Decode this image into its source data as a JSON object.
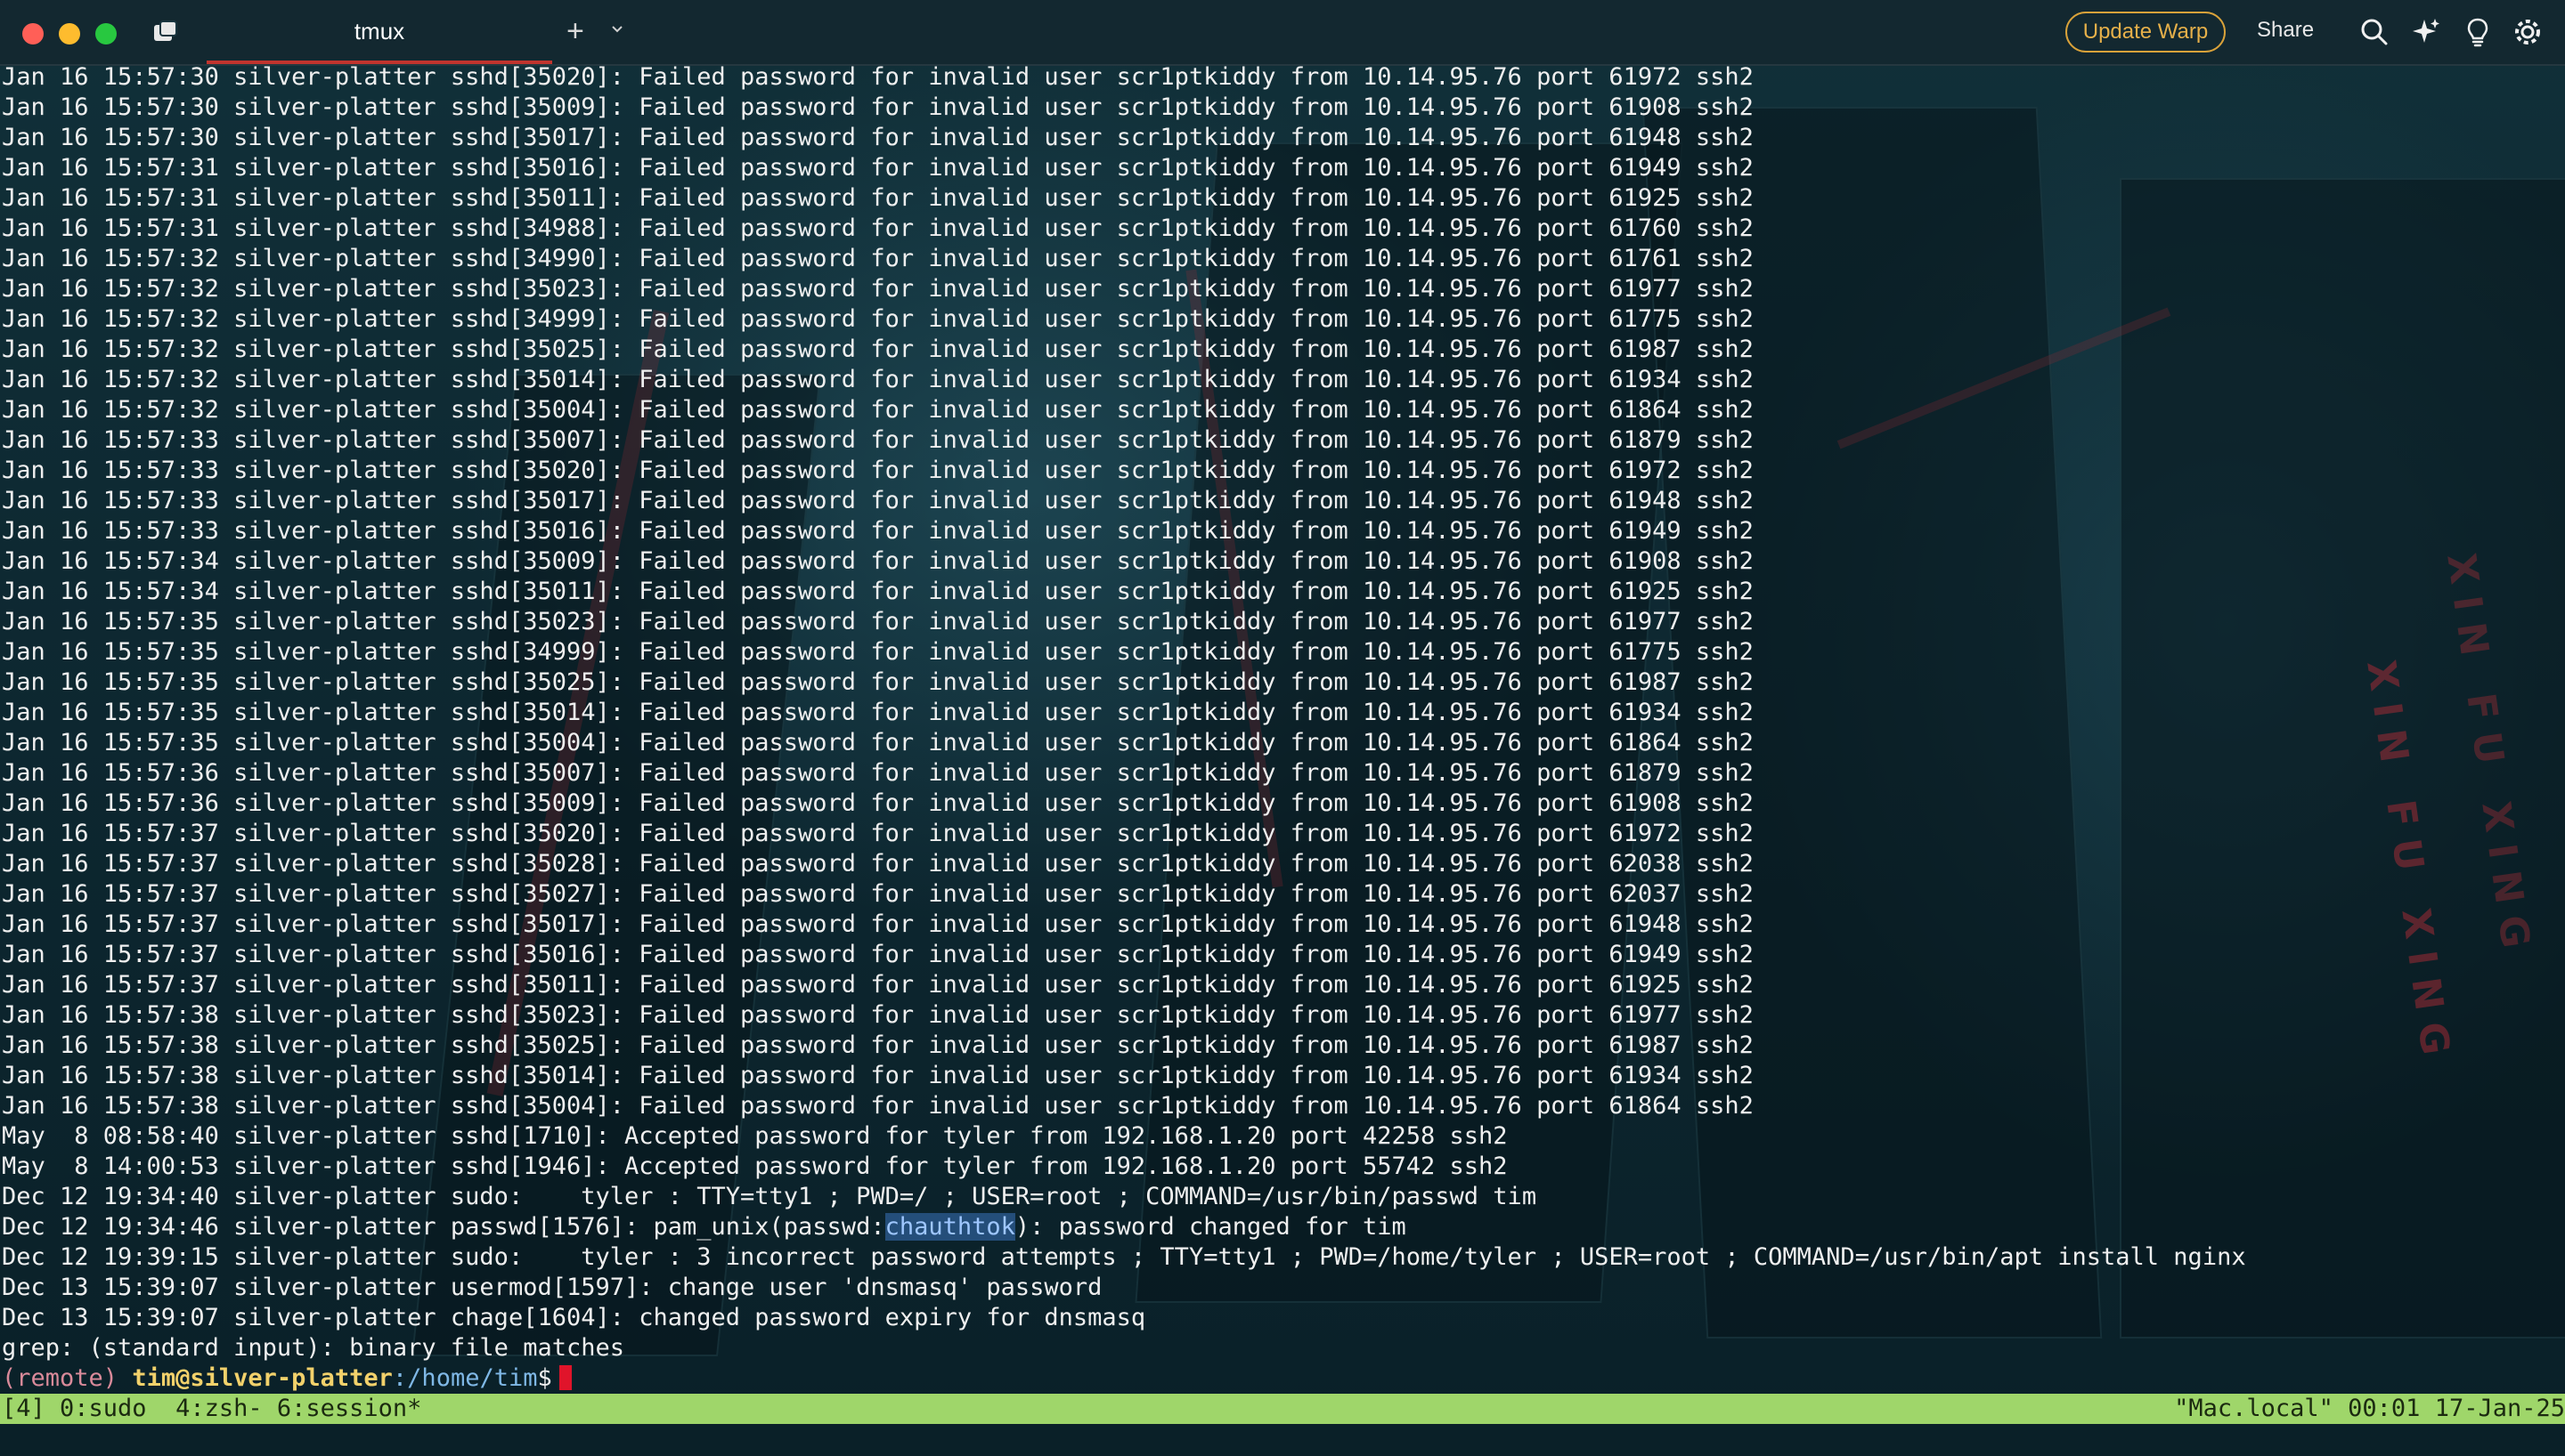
{
  "window": {
    "tab_title": "tmux",
    "new_tab_label": "+",
    "update_button": "Update Warp",
    "share_button": "Share",
    "colors": {
      "tab_accent": "#c0342e",
      "update_accent": "#d9a23a",
      "status_bar": "#9fd66a",
      "cursor": "#e0142a"
    },
    "icons": [
      "tabs-panel-icon",
      "plus-icon",
      "chevron-down-icon",
      "search-icon",
      "ai-sparkle-icon",
      "lightbulb-icon",
      "settings-gear-icon"
    ]
  },
  "terminal": {
    "lines": [
      "Jan 16 15:57:30 silver-platter sshd[35020]: Failed password for invalid user scr1ptkiddy from 10.14.95.76 port 61972 ssh2",
      "Jan 16 15:57:30 silver-platter sshd[35009]: Failed password for invalid user scr1ptkiddy from 10.14.95.76 port 61908 ssh2",
      "Jan 16 15:57:30 silver-platter sshd[35017]: Failed password for invalid user scr1ptkiddy from 10.14.95.76 port 61948 ssh2",
      "Jan 16 15:57:31 silver-platter sshd[35016]: Failed password for invalid user scr1ptkiddy from 10.14.95.76 port 61949 ssh2",
      "Jan 16 15:57:31 silver-platter sshd[35011]: Failed password for invalid user scr1ptkiddy from 10.14.95.76 port 61925 ssh2",
      "Jan 16 15:57:31 silver-platter sshd[34988]: Failed password for invalid user scr1ptkiddy from 10.14.95.76 port 61760 ssh2",
      "Jan 16 15:57:32 silver-platter sshd[34990]: Failed password for invalid user scr1ptkiddy from 10.14.95.76 port 61761 ssh2",
      "Jan 16 15:57:32 silver-platter sshd[35023]: Failed password for invalid user scr1ptkiddy from 10.14.95.76 port 61977 ssh2",
      "Jan 16 15:57:32 silver-platter sshd[34999]: Failed password for invalid user scr1ptkiddy from 10.14.95.76 port 61775 ssh2",
      "Jan 16 15:57:32 silver-platter sshd[35025]: Failed password for invalid user scr1ptkiddy from 10.14.95.76 port 61987 ssh2",
      "Jan 16 15:57:32 silver-platter sshd[35014]: Failed password for invalid user scr1ptkiddy from 10.14.95.76 port 61934 ssh2",
      "Jan 16 15:57:32 silver-platter sshd[35004]: Failed password for invalid user scr1ptkiddy from 10.14.95.76 port 61864 ssh2",
      "Jan 16 15:57:33 silver-platter sshd[35007]: Failed password for invalid user scr1ptkiddy from 10.14.95.76 port 61879 ssh2",
      "Jan 16 15:57:33 silver-platter sshd[35020]: Failed password for invalid user scr1ptkiddy from 10.14.95.76 port 61972 ssh2",
      "Jan 16 15:57:33 silver-platter sshd[35017]: Failed password for invalid user scr1ptkiddy from 10.14.95.76 port 61948 ssh2",
      "Jan 16 15:57:33 silver-platter sshd[35016]: Failed password for invalid user scr1ptkiddy from 10.14.95.76 port 61949 ssh2",
      "Jan 16 15:57:34 silver-platter sshd[35009]: Failed password for invalid user scr1ptkiddy from 10.14.95.76 port 61908 ssh2",
      "Jan 16 15:57:34 silver-platter sshd[35011]: Failed password for invalid user scr1ptkiddy from 10.14.95.76 port 61925 ssh2",
      "Jan 16 15:57:35 silver-platter sshd[35023]: Failed password for invalid user scr1ptkiddy from 10.14.95.76 port 61977 ssh2",
      "Jan 16 15:57:35 silver-platter sshd[34999]: Failed password for invalid user scr1ptkiddy from 10.14.95.76 port 61775 ssh2",
      "Jan 16 15:57:35 silver-platter sshd[35025]: Failed password for invalid user scr1ptkiddy from 10.14.95.76 port 61987 ssh2",
      "Jan 16 15:57:35 silver-platter sshd[35014]: Failed password for invalid user scr1ptkiddy from 10.14.95.76 port 61934 ssh2",
      "Jan 16 15:57:35 silver-platter sshd[35004]: Failed password for invalid user scr1ptkiddy from 10.14.95.76 port 61864 ssh2",
      "Jan 16 15:57:36 silver-platter sshd[35007]: Failed password for invalid user scr1ptkiddy from 10.14.95.76 port 61879 ssh2",
      "Jan 16 15:57:36 silver-platter sshd[35009]: Failed password for invalid user scr1ptkiddy from 10.14.95.76 port 61908 ssh2",
      "Jan 16 15:57:37 silver-platter sshd[35020]: Failed password for invalid user scr1ptkiddy from 10.14.95.76 port 61972 ssh2",
      "Jan 16 15:57:37 silver-platter sshd[35028]: Failed password for invalid user scr1ptkiddy from 10.14.95.76 port 62038 ssh2",
      "Jan 16 15:57:37 silver-platter sshd[35027]: Failed password for invalid user scr1ptkiddy from 10.14.95.76 port 62037 ssh2",
      "Jan 16 15:57:37 silver-platter sshd[35017]: Failed password for invalid user scr1ptkiddy from 10.14.95.76 port 61948 ssh2",
      "Jan 16 15:57:37 silver-platter sshd[35016]: Failed password for invalid user scr1ptkiddy from 10.14.95.76 port 61949 ssh2",
      "Jan 16 15:57:37 silver-platter sshd[35011]: Failed password for invalid user scr1ptkiddy from 10.14.95.76 port 61925 ssh2",
      "Jan 16 15:57:38 silver-platter sshd[35023]: Failed password for invalid user scr1ptkiddy from 10.14.95.76 port 61977 ssh2",
      "Jan 16 15:57:38 silver-platter sshd[35025]: Failed password for invalid user scr1ptkiddy from 10.14.95.76 port 61987 ssh2",
      "Jan 16 15:57:38 silver-platter sshd[35014]: Failed password for invalid user scr1ptkiddy from 10.14.95.76 port 61934 ssh2",
      "Jan 16 15:57:38 silver-platter sshd[35004]: Failed password for invalid user scr1ptkiddy from 10.14.95.76 port 61864 ssh2",
      "May  8 08:58:40 silver-platter sshd[1710]: Accepted password for tyler from 192.168.1.20 port 42258 ssh2",
      "May  8 14:00:53 silver-platter sshd[1946]: Accepted password for tyler from 192.168.1.20 port 55742 ssh2",
      "Dec 12 19:34:40 silver-platter sudo:    tyler : TTY=tty1 ; PWD=/ ; USER=root ; COMMAND=/usr/bin/passwd tim"
    ],
    "passwd_line": {
      "before": "Dec 12 19:34:46 silver-platter passwd[1576]: pam_unix(passwd:",
      "highlight": "chauthtok",
      "after": "): password changed for tim"
    },
    "lines_after": [
      "Dec 12 19:39:15 silver-platter sudo:    tyler : 3 incorrect password attempts ; TTY=tty1 ; PWD=/home/tyler ; USER=root ; COMMAND=/usr/bin/apt install nginx",
      "Dec 13 15:39:07 silver-platter usermod[1597]: change user 'dnsmasq' password",
      "Dec 13 15:39:07 silver-platter chage[1604]: changed password expiry for dnsmasq",
      "grep: (standard input): binary file matches"
    ],
    "prompt": {
      "remote": "(remote)",
      "user_host": "tim@silver-platter",
      "path": ":/home/tim",
      "symbol": "$"
    }
  },
  "tmux": {
    "left": "[4] 0:sudo  4:zsh- 6:session*",
    "right": "\"Mac.local\" 00:01 17-Jan-25"
  },
  "background": {
    "sign_text_1": "XIN FU XING",
    "sign_text_2": "XIN FU XING"
  }
}
